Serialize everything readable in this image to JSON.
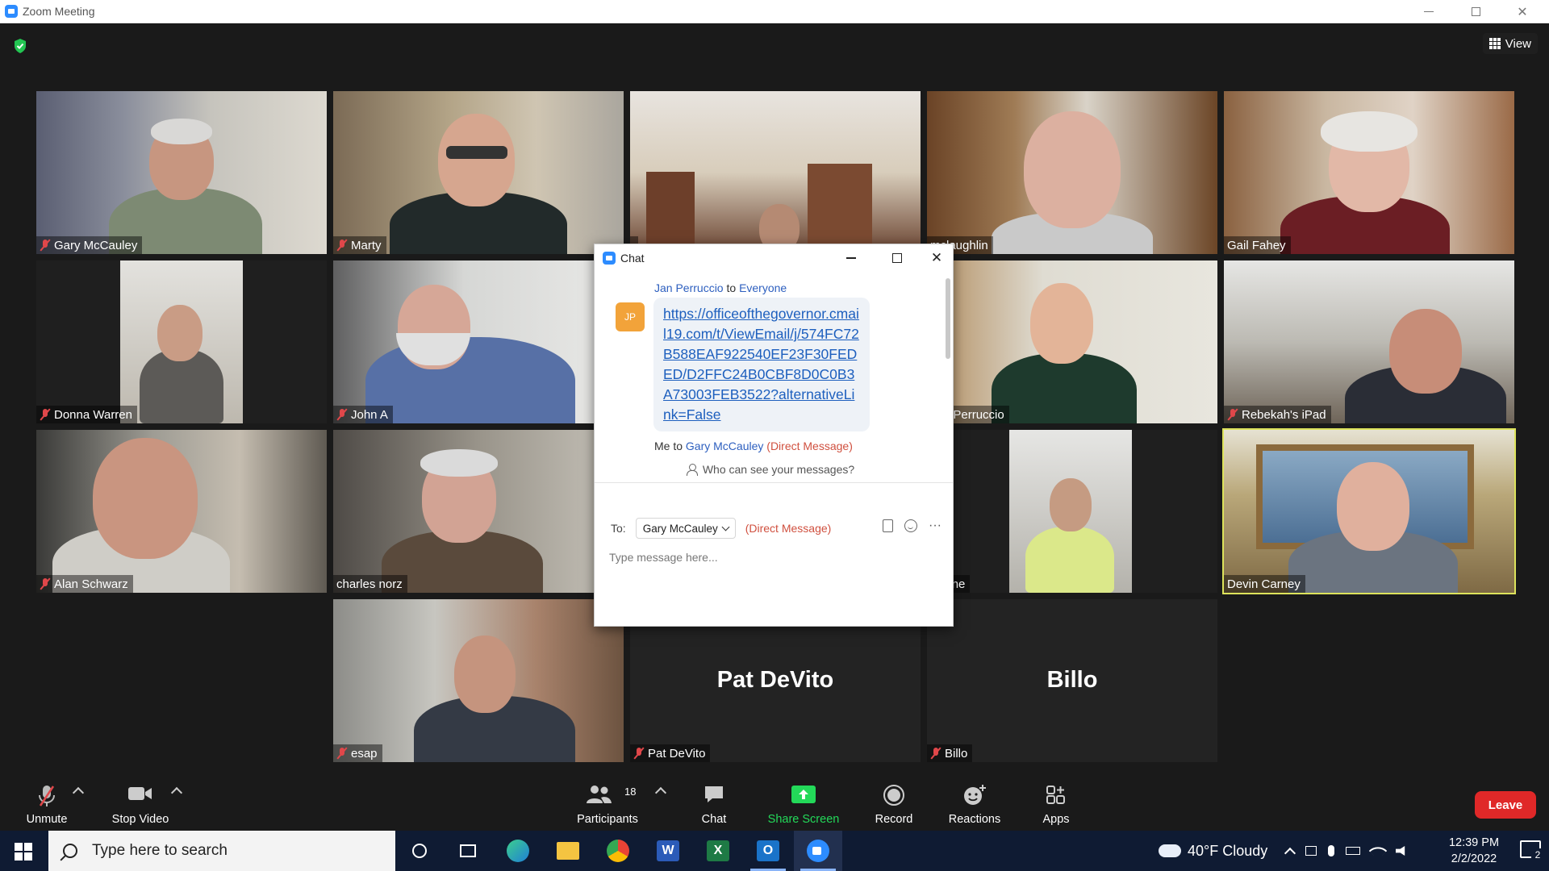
{
  "window": {
    "title": "Zoom Meeting"
  },
  "view_label": "View",
  "tiles": [
    {
      "name": "Gary McCauley",
      "muted": true
    },
    {
      "name": "Marty",
      "muted": true
    },
    {
      "name": "",
      "muted": false
    },
    {
      "name": "mclaughlin",
      "muted": false
    },
    {
      "name": "Gail Fahey",
      "muted": false
    },
    {
      "name": "Donna  Warren",
      "muted": true
    },
    {
      "name": "John A",
      "muted": true
    },
    {
      "name": "Jan Perruccio",
      "muted": false
    },
    {
      "name": "Rebekah's iPad",
      "muted": true
    },
    {
      "name": "Alan Schwarz",
      "muted": true
    },
    {
      "name": "charles norz",
      "muted": false
    },
    {
      "name": "Phone",
      "muted": false
    },
    {
      "name": "Devin Carney",
      "muted": false,
      "active": true
    },
    {
      "name": "esap",
      "muted": true
    },
    {
      "name": "Pat DeVito",
      "muted": true,
      "no_video": true
    },
    {
      "name": "Billo",
      "muted": true,
      "no_video": true
    }
  ],
  "chat": {
    "title": "Chat",
    "message1": {
      "sender": "Jan Perruccio",
      "to_word": "to",
      "recipient": "Everyone",
      "avatar_initials": "JP",
      "link": "https://officeofthegovernor.cmail19.com/t/ViewEmail/j/574FC72B588EAF922540EF23F30FEDED/D2FFC24B0CBF8D0C0B3A73003FEB3522?alternativeLink=False"
    },
    "message2": {
      "sender": "Me",
      "to_word": "to",
      "recipient": "Gary McCauley",
      "tag": "(Direct Message)"
    },
    "who_can_see": "Who can see your messages?",
    "to_label": "To:",
    "to_value": "Gary McCauley",
    "direct_tag": "(Direct Message)",
    "more": "···",
    "placeholder": "Type message here..."
  },
  "toolbar": {
    "unmute": "Unmute",
    "stop_video": "Stop Video",
    "participants": "Participants",
    "participants_count": "18",
    "chat": "Chat",
    "share_screen": "Share Screen",
    "record": "Record",
    "reactions": "Reactions",
    "apps": "Apps",
    "leave": "Leave"
  },
  "taskbar": {
    "search_placeholder": "Type here to search",
    "weather": "40°F  Cloudy",
    "time": "12:39 PM",
    "date": "2/2/2022",
    "notif_count": "2"
  },
  "colors": {
    "accent": "#2d8cff",
    "leave": "#e02828",
    "share": "#23d959",
    "active_speaker": "#dde35b",
    "muted": "#e0474a"
  }
}
